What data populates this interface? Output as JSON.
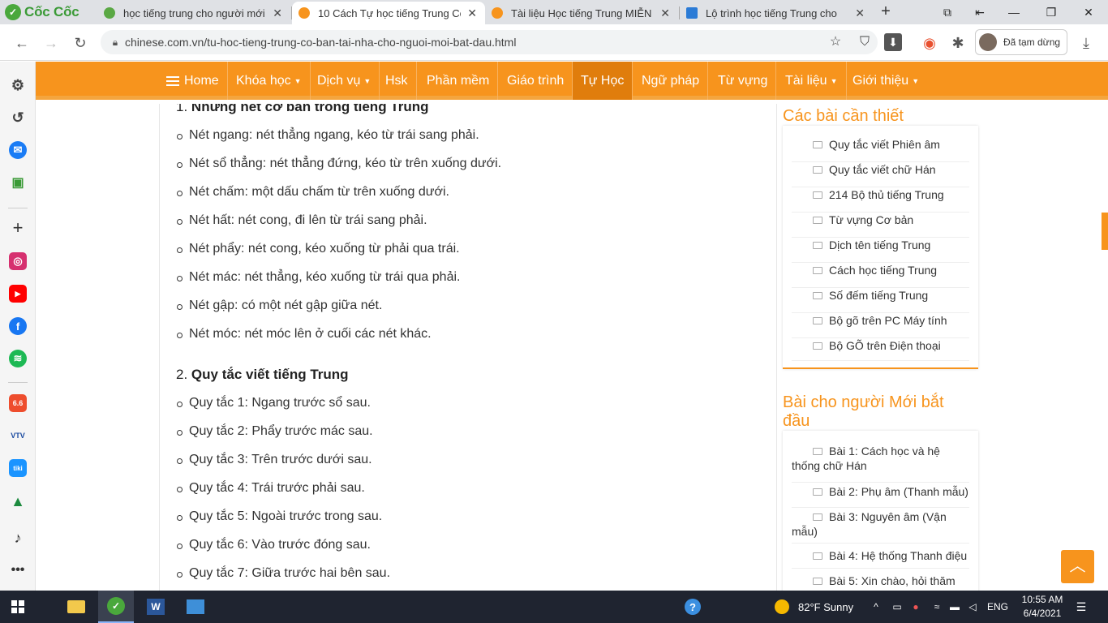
{
  "browser": {
    "brand": "Cốc Cốc",
    "tabs": [
      {
        "title": "học tiếng trung cho người mới",
        "favicon_color": "#5aa844"
      },
      {
        "title": "10 Cách Tự học tiếng Trung Cơ",
        "favicon_color": "#f7941d"
      },
      {
        "title": "Tài liệu Học tiếng Trung MIỄN",
        "favicon_color": "#f7941d"
      },
      {
        "title": "Lộ trình học tiếng Trung cho",
        "favicon_color": "#2b7bd6"
      }
    ],
    "url": "chinese.com.vn/tu-hoc-tieng-trung-co-ban-tai-nha-cho-nguoi-moi-bat-dau.html",
    "paused_label": "Đã tạm dừng"
  },
  "sitenav": {
    "items": [
      {
        "label": "Home",
        "dropdown": false
      },
      {
        "label": "Khóa học",
        "dropdown": true
      },
      {
        "label": "Dịch vụ",
        "dropdown": true
      },
      {
        "label": "Hsk",
        "dropdown": false
      },
      {
        "label": "Phần mềm",
        "dropdown": false
      },
      {
        "label": "Giáo trình",
        "dropdown": false
      },
      {
        "label": "Tự Học",
        "dropdown": false
      },
      {
        "label": "Ngữ pháp",
        "dropdown": false
      },
      {
        "label": "Từ vựng",
        "dropdown": false
      },
      {
        "label": "Tài liệu",
        "dropdown": true
      },
      {
        "label": "Giới thiệu",
        "dropdown": true
      }
    ],
    "active": "Tự Học",
    "color": "#f7941d"
  },
  "article": {
    "section1": {
      "number": "1.",
      "title": "Những nét cơ bản trong tiếng Trung"
    },
    "strokes": [
      "Nét ngang: nét thẳng ngang, kéo từ trái sang phải.",
      "Nét sổ thẳng: nét thẳng đứng, kéo từ trên xuống dưới.",
      "Nét chấm: một dấu chấm từ trên xuống dưới.",
      "Nét hất: nét cong, đi lên từ trái sang phải.",
      "Nét phẩy: nét cong, kéo xuống từ phải qua trái.",
      "Nét mác: nét thẳng, kéo xuống từ trái qua phải.",
      "Nét gập: có một nét gập giữa nét.",
      "Nét móc: nét móc lên ở cuối các nét khác."
    ],
    "section2": {
      "number": "2.",
      "title": "Quy tắc viết tiếng Trung"
    },
    "rules": [
      "Quy tắc 1: Ngang trước sổ sau.",
      "Quy tắc 2: Phẩy trước mác sau.",
      "Quy tắc 3: Trên trước dưới sau.",
      "Quy tắc 4: Trái trước phải sau.",
      "Quy tắc 5: Ngoài trước trong sau.",
      "Quy tắc 6: Vào trước đóng sau.",
      "Quy tắc 7: Giữa trước hai bên sau."
    ]
  },
  "aside": {
    "essential_title": "Các bài cần thiết",
    "essential_items": [
      "Quy tắc viết Phiên âm",
      "Quy tắc viết chữ Hán",
      "214 Bộ thủ tiếng Trung",
      "Từ vựng Cơ bản",
      "Dịch tên tiếng Trung",
      "Cách học tiếng Trung",
      "Số đếm tiếng Trung",
      "Bộ gõ trên PC Máy tính",
      "Bộ GÕ trên Điện thoại"
    ],
    "beginner_title": "Bài cho người Mới bắt đầu",
    "beginner_items": [
      "Bài 1: Cách học và hệ thống chữ Hán",
      "Bài 2: Phụ âm (Thanh mẫu)",
      "Bài 3: Nguyên âm (Vận mẫu)",
      "Bài 4: Hệ thống Thanh điệu",
      "Bài 5: Xin chào, hỏi thăm"
    ]
  },
  "taskbar": {
    "weather": "82°F  Sunny",
    "language": "ENG",
    "time": "10:55 AM",
    "date": "6/4/2021"
  }
}
